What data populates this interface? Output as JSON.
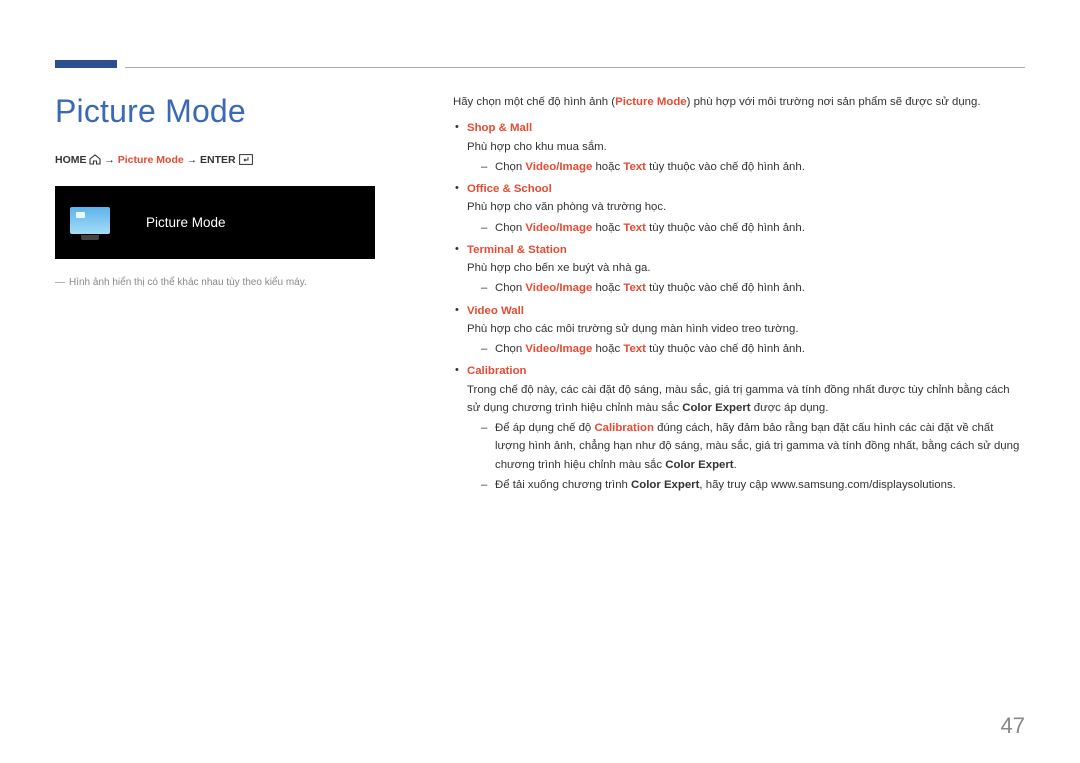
{
  "page_number": "47",
  "title": "Picture Mode",
  "breadcrumb": {
    "home": "HOME",
    "arrow1": "→",
    "current": "Picture Mode",
    "arrow2": "→",
    "enter": "ENTER"
  },
  "preview": {
    "label": "Picture Mode"
  },
  "left_footnote": "Hình ảnh hiển thị có thể khác nhau tùy theo kiểu máy.",
  "intro": {
    "pre": "Hãy chọn một chế độ hình ảnh (",
    "key": "Picture Mode",
    "post": ") phù hợp với môi trường nơi sản phẩm sẽ được sử dụng."
  },
  "items": [
    {
      "title": "Shop & Mall",
      "desc": "Phù hợp cho khu mua sắm.",
      "sub": [
        {
          "pre": "Chọn ",
          "k1": "Video/Image",
          "mid": " hoặc ",
          "k2": "Text",
          "post": " tùy thuộc vào chế độ hình ảnh."
        }
      ]
    },
    {
      "title": "Office & School",
      "desc": "Phù hợp cho văn phòng và trường học.",
      "sub": [
        {
          "pre": "Chọn ",
          "k1": "Video/Image",
          "mid": " hoặc ",
          "k2": "Text",
          "post": " tùy thuộc vào chế độ hình ảnh."
        }
      ]
    },
    {
      "title": "Terminal & Station",
      "desc": "Phù hợp cho bến xe buýt và nhà ga.",
      "sub": [
        {
          "pre": "Chọn ",
          "k1": "Video/Image",
          "mid": " hoặc ",
          "k2": "Text",
          "post": " tùy thuộc vào chế độ hình ảnh."
        }
      ]
    },
    {
      "title": "Video Wall",
      "desc": "Phù hợp cho các môi trường sử dụng màn hình video treo tường.",
      "sub": [
        {
          "pre": "Chọn ",
          "k1": "Video/Image",
          "mid": " hoặc ",
          "k2": "Text",
          "post": " tùy thuộc vào chế độ hình ảnh."
        }
      ]
    }
  ],
  "calibration": {
    "title": "Calibration",
    "desc_pre": "Trong chế độ này, các cài đặt độ sáng, màu sắc, giá trị gamma và tính đồng nhất được tùy chỉnh bằng cách sử dụng chương trình hiệu chỉnh màu sắc ",
    "desc_bold": "Color Expert",
    "desc_post": " được áp dụng.",
    "sub1_pre": "Để áp dụng chế độ ",
    "sub1_key": "Calibration",
    "sub1_mid": " đúng cách, hãy đảm bảo rằng bạn đặt cấu hình các cài đặt về chất lượng hình ảnh, chẳng hạn như độ sáng, màu sắc, giá trị gamma và tính đồng nhất, bằng cách sử dụng chương trình hiệu chỉnh màu sắc ",
    "sub1_bold": "Color Expert",
    "sub1_post": ".",
    "sub2_pre": "Để tải xuống chương trình ",
    "sub2_bold": "Color Expert",
    "sub2_post": ", hãy truy cập www.samsung.com/displaysolutions."
  }
}
